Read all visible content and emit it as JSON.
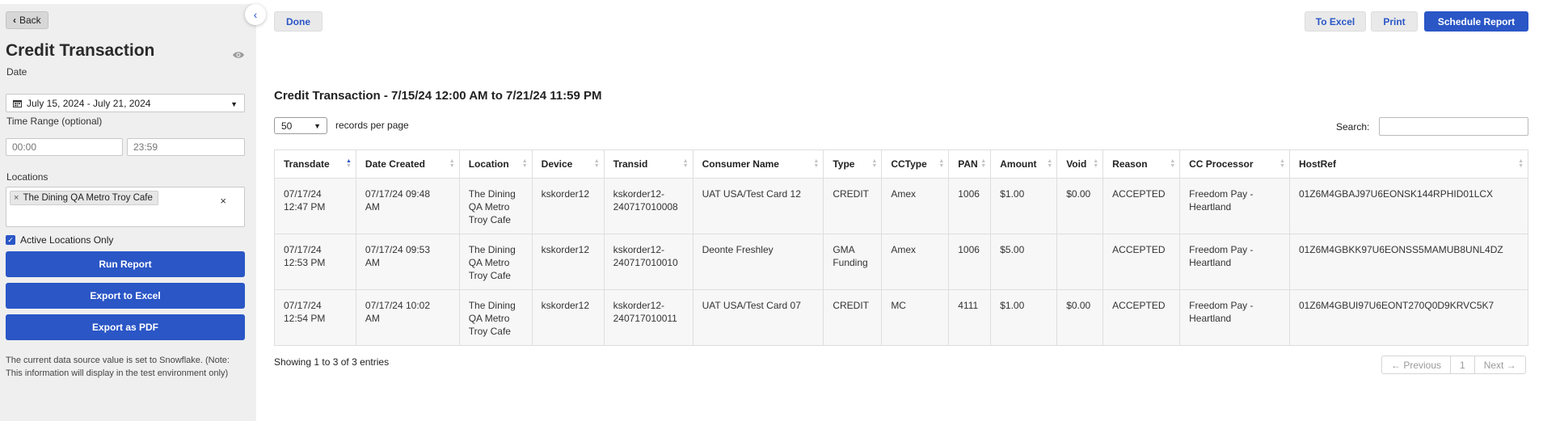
{
  "sidebar": {
    "back_label": "Back",
    "title": "Credit Transaction",
    "date_label": "Date",
    "date_value": "July 15, 2024 - July 21, 2024",
    "time_range_label": "Time Range (optional)",
    "time_from_placeholder": "00:00",
    "time_to_placeholder": "23:59",
    "locations_label": "Locations",
    "location_tag": "The Dining QA Metro Troy Cafe",
    "active_only_label": "Active Locations Only",
    "run_report_label": "Run Report",
    "export_excel_label": "Export to Excel",
    "export_pdf_label": "Export as PDF",
    "note": "The current data source value is set to Snowflake. (Note: This information will display in the test environment only)"
  },
  "toolbar": {
    "done_label": "Done",
    "to_excel_label": "To Excel",
    "print_label": "Print",
    "schedule_label": "Schedule Report"
  },
  "report": {
    "title": "Credit Transaction - 7/15/24 12:00 AM to 7/21/24 11:59 PM",
    "per_page_value": "50",
    "per_page_label": "records per page",
    "search_label": "Search:",
    "columns": [
      "Transdate",
      "Date Created",
      "Location",
      "Device",
      "Transid",
      "Consumer Name",
      "Type",
      "CCType",
      "PAN",
      "Amount",
      "Void",
      "Reason",
      "CC Processor",
      "HostRef"
    ],
    "rows": [
      [
        "07/17/24\n12:47 PM",
        "07/17/24 09:48\nAM",
        "The Dining\nQA Metro\nTroy Cafe",
        "kskorder12",
        "kskorder12-\n240717010008",
        "UAT USA/Test Card 12",
        "CREDIT",
        "Amex",
        "1006",
        "$1.00",
        "$0.00",
        "ACCEPTED",
        "Freedom Pay -\nHeartland",
        "01Z6M4GBAJ97U6EONSK144RPHID01LCX"
      ],
      [
        "07/17/24\n12:53 PM",
        "07/17/24 09:53\nAM",
        "The Dining\nQA Metro\nTroy Cafe",
        "kskorder12",
        "kskorder12-\n240717010010",
        "Deonte Freshley",
        "GMA\nFunding",
        "Amex",
        "1006",
        "$5.00",
        "",
        "ACCEPTED",
        "Freedom Pay -\nHeartland",
        "01Z6M4GBKK97U6EONSS5MAMUB8UNL4DZ"
      ],
      [
        "07/17/24\n12:54 PM",
        "07/17/24 10:02\nAM",
        "The Dining\nQA Metro\nTroy Cafe",
        "kskorder12",
        "kskorder12-\n240717010011",
        "UAT USA/Test Card 07",
        "CREDIT",
        "MC",
        "4111",
        "$1.00",
        "$0.00",
        "ACCEPTED",
        "Freedom Pay -\nHeartland",
        "01Z6M4GBUI97U6EONT270Q0D9KRVC5K7"
      ]
    ],
    "showing_text": "Showing 1 to 3 of 3 entries",
    "pager": {
      "previous_label": "← Previous",
      "page": "1",
      "next_label": "Next →"
    }
  },
  "colors": {
    "accent": "#2a56c6",
    "sidebar_bg": "#efefef"
  }
}
